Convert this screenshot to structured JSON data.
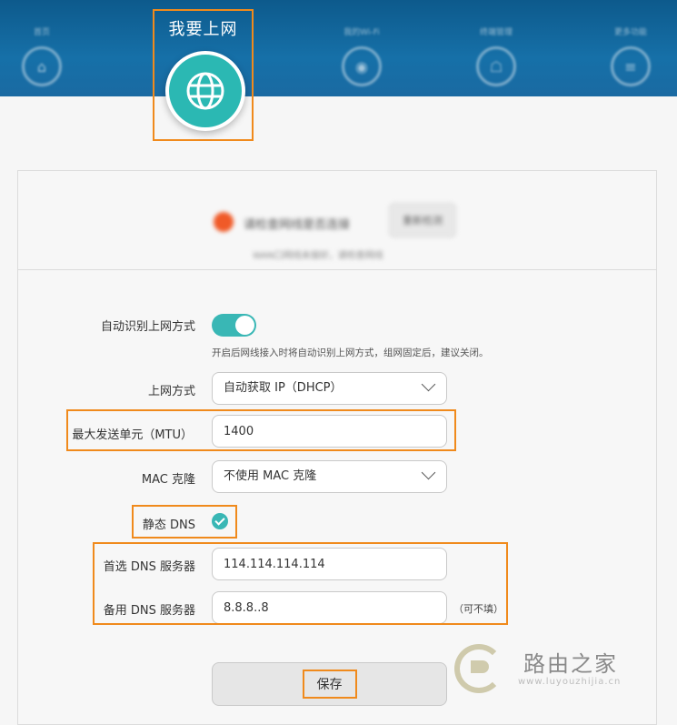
{
  "header": {
    "active_tab_label": "我要上网",
    "other_tabs": [
      {
        "label": "首页",
        "icon": "home-icon"
      },
      {
        "label": "我的Wi-Fi",
        "icon": "wifi-icon"
      },
      {
        "label": "终端管理",
        "icon": "devices-icon"
      },
      {
        "label": "更多功能",
        "icon": "menu-icon"
      }
    ]
  },
  "status": {
    "text": "请检查网线是否连接",
    "button_label": "重新检测",
    "sub_text": "WAN口网线未接好，请检查网线"
  },
  "form": {
    "auto_detect": {
      "label": "自动识别上网方式",
      "enabled": true,
      "hint": "开启后网线接入时将自动识别上网方式，组网固定后，建议关闭。"
    },
    "connection_mode": {
      "label": "上网方式",
      "value": "自动获取 IP（DHCP）"
    },
    "mtu": {
      "label": "最大发送单元（MTU）",
      "value": "1400"
    },
    "mac_clone": {
      "label": "MAC 克隆",
      "value": "不使用 MAC 克隆"
    },
    "static_dns": {
      "label": "静态 DNS",
      "checked": true
    },
    "primary_dns": {
      "label": "首选 DNS 服务器",
      "value": "114.114.114.114"
    },
    "secondary_dns": {
      "label": "备用 DNS 服务器",
      "value": "8.8.8..8",
      "note": "（可不填）"
    },
    "save_label": "保存"
  },
  "watermark": {
    "text": "路由之家",
    "url": "www.luyouzhijia.cn"
  },
  "colors": {
    "accent": "#39b7b5",
    "highlight": "#f08a1c",
    "header": "#1670a8",
    "status_dot": "#f05a28"
  }
}
